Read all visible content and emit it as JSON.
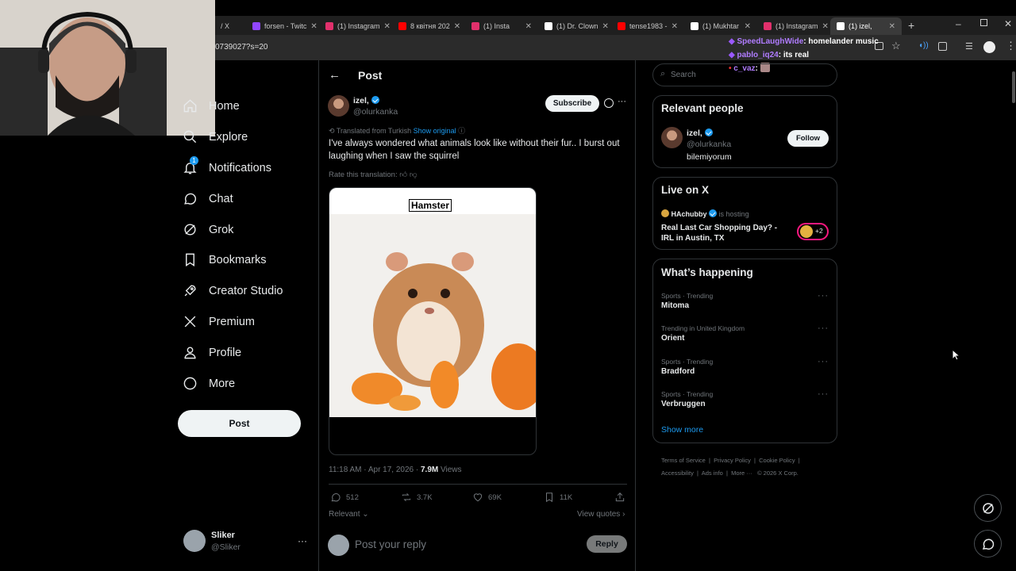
{
  "browser": {
    "tabs": [
      {
        "label": "/ X",
        "icon": "x-logo-icon",
        "color": "#ffffff"
      },
      {
        "label": "forsen - Twitc",
        "icon": "twitch-icon",
        "color": "#9146ff"
      },
      {
        "label": "(1) Instagram",
        "icon": "instagram-icon",
        "color": "#e1306c"
      },
      {
        "label": "8 квітня 202",
        "icon": "youtube-icon",
        "color": "#ff0000"
      },
      {
        "label": "(1) Insta",
        "icon": "instagram-icon",
        "color": "#e1306c"
      },
      {
        "label": "(1) Dr. Clown",
        "icon": "x-logo-icon",
        "color": "#ffffff"
      },
      {
        "label": "tense1983 -",
        "icon": "youtube-icon",
        "color": "#ff0000"
      },
      {
        "label": "(1) Mukhtar",
        "icon": "x-logo-icon",
        "color": "#ffffff"
      },
      {
        "label": "(1) Instagram",
        "icon": "instagram-icon",
        "color": "#e1306c"
      },
      {
        "label": "(1) izel, ",
        "icon": "x-logo-icon",
        "color": "#ffffff"
      }
    ],
    "url": "0739027?s=20"
  },
  "stream_chat": [
    {
      "user": "SpeedLaughWide",
      "text": ": homelander music",
      "color": "#9b59ff"
    },
    {
      "user": "pablo_iq24",
      "text": ": its real",
      "color": "#9b59ff"
    },
    {
      "user": "c_vaz",
      "text": ":",
      "color": "#9b59ff"
    }
  ],
  "nav": {
    "items": [
      {
        "label": "Home",
        "icon": "home-icon"
      },
      {
        "label": "Explore",
        "icon": "search-icon"
      },
      {
        "label": "Notifications",
        "icon": "bell-icon",
        "badge": "1"
      },
      {
        "label": "Chat",
        "icon": "chat-icon"
      },
      {
        "label": "Grok",
        "icon": "grok-icon"
      },
      {
        "label": "Bookmarks",
        "icon": "bookmark-icon"
      },
      {
        "label": "Creator Studio",
        "icon": "rocket-icon"
      },
      {
        "label": "Premium",
        "icon": "x-logo-icon"
      },
      {
        "label": "Profile",
        "icon": "person-icon"
      },
      {
        "label": "More",
        "icon": "more-circle-icon"
      }
    ],
    "post_label": "Post",
    "account": {
      "name": "Sliker",
      "handle": "@Sliker"
    }
  },
  "post": {
    "header_title": "Post",
    "author_name": "izel,",
    "author_handle": "@olurkanka",
    "subscribe_label": "Subscribe",
    "translated_note": "Translated from Turkish",
    "show_original": "Show original",
    "text": "I've always wondered what animals look like without their fur.. I burst out laughing when I saw the squirrel",
    "rate_translation": "Rate this translation:",
    "image_caption": "Hamster",
    "time": "11:18 AM · Apr 17, 2026 · ",
    "views": "7.9M",
    "views_label": "Views",
    "replies": "512",
    "reposts": "3.7K",
    "likes": "69K",
    "bookmarks": "11K",
    "sort_label": "Relevant",
    "view_quotes": "View quotes",
    "reply_placeholder": "Post your reply",
    "reply_button": "Reply"
  },
  "sidebar": {
    "search_placeholder": "Search",
    "relevant_title": "Relevant people",
    "person": {
      "name": "izel,",
      "handle": "@olurkanka",
      "bio": "bilemiyorum",
      "follow": "Follow"
    },
    "live_title": "Live on X",
    "live": {
      "host": "HAchubby",
      "hosting": "is hosting",
      "title": "Real Last Car Shopping Day? - IRL in Austin, TX",
      "extra": "+2"
    },
    "happening_title": "What’s happening",
    "trends": [
      {
        "context": "Sports · Trending",
        "name": "Mitoma"
      },
      {
        "context": "Trending in United Kingdom",
        "name": "Orient"
      },
      {
        "context": "Sports · Trending",
        "name": "Bradford"
      },
      {
        "context": "Sports · Trending",
        "name": "Verbruggen"
      }
    ],
    "show_more": "Show more",
    "footer": [
      "Terms of Service",
      "Privacy Policy",
      "Cookie Policy",
      "Accessibility",
      "Ads info",
      "More ···",
      "© 2026 X Corp."
    ]
  }
}
